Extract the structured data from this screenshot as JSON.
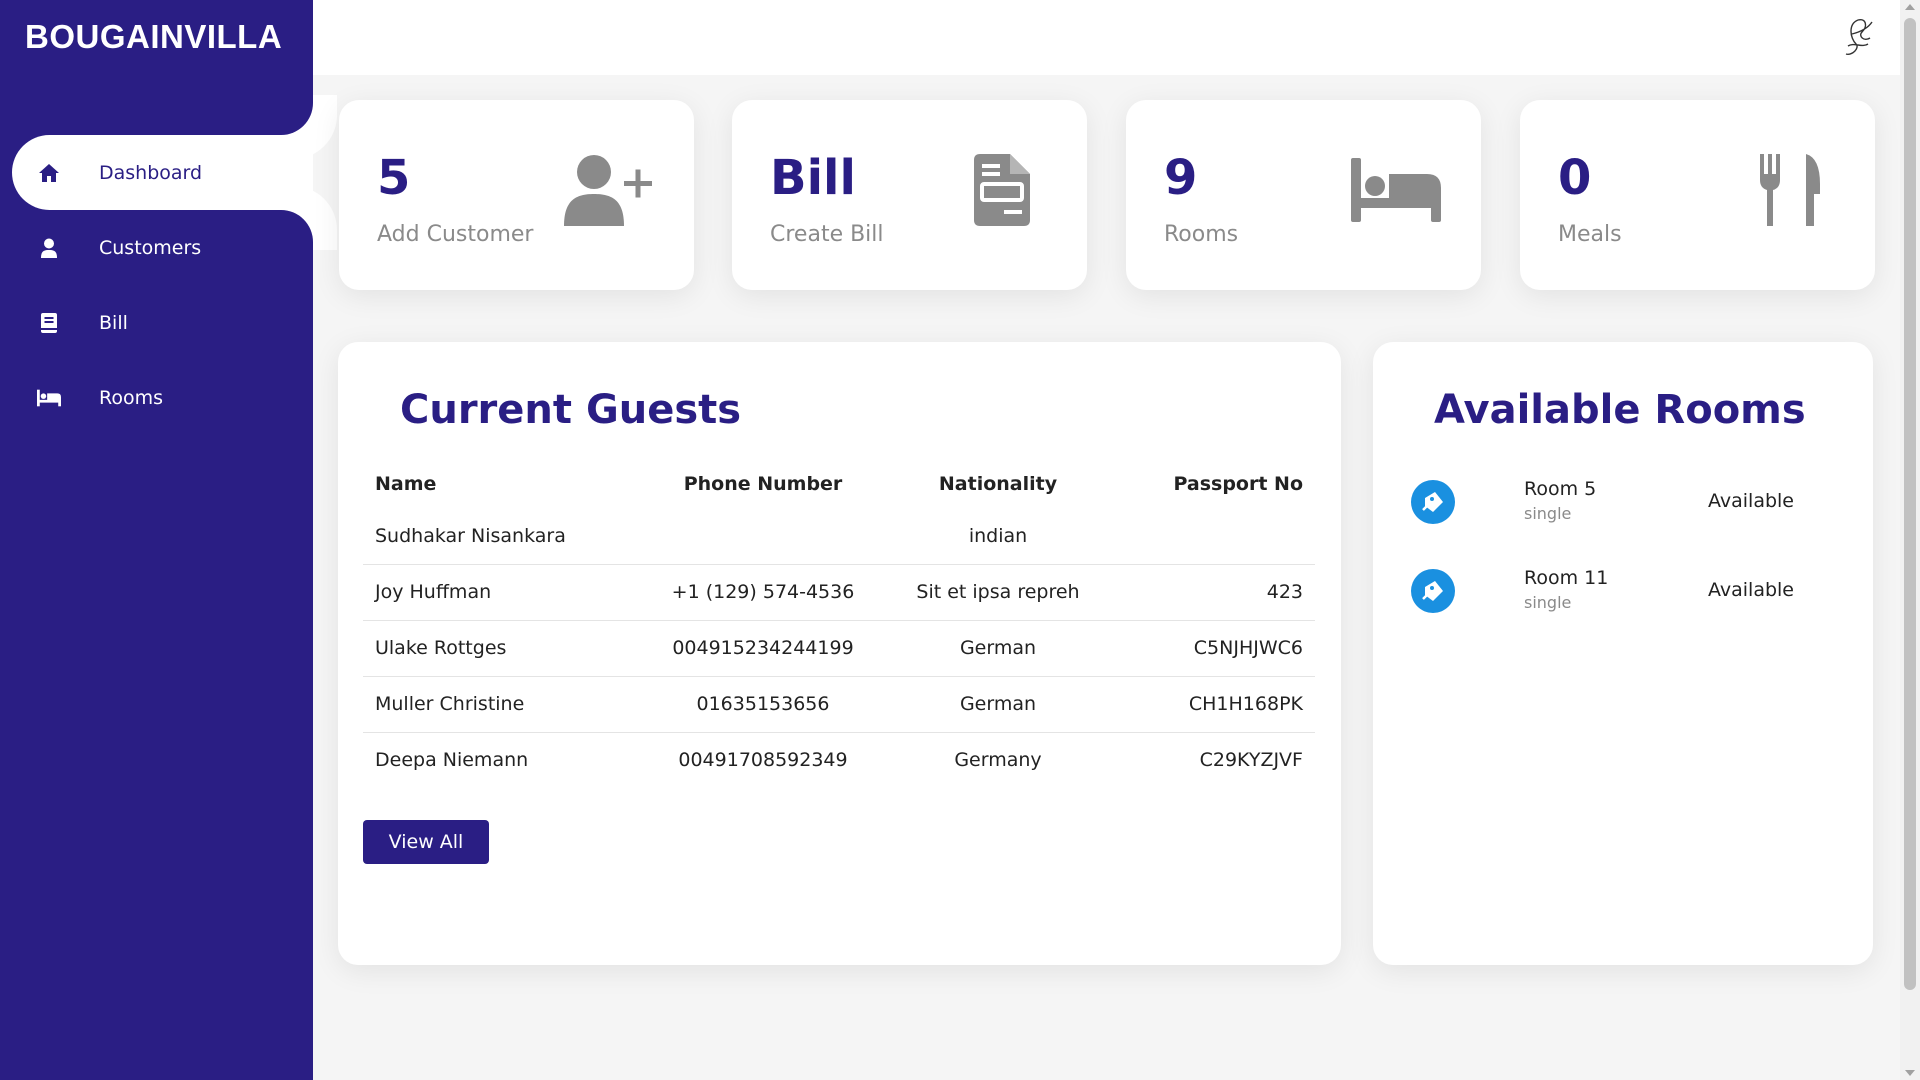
{
  "brand": "BOUGAINVILLA",
  "nav": {
    "items": [
      {
        "label": "Dashboard",
        "icon": "home-icon",
        "active": true
      },
      {
        "label": "Customers",
        "icon": "user-icon"
      },
      {
        "label": "Bill",
        "icon": "book-icon"
      },
      {
        "label": "Rooms",
        "icon": "bed-icon"
      }
    ]
  },
  "cards": [
    {
      "value": "5",
      "label": "Add Customer",
      "icon": "add-user-icon"
    },
    {
      "value": "Bill",
      "label": "Create Bill",
      "icon": "document-icon"
    },
    {
      "value": "9",
      "label": "Rooms",
      "icon": "bed-icon"
    },
    {
      "value": "0",
      "label": "Meals",
      "icon": "utensils-icon"
    }
  ],
  "guests": {
    "title": "Current Guests",
    "columns": [
      "Name",
      "Phone Number",
      "Nationality",
      "Passport No"
    ],
    "rows": [
      {
        "name": "Sudhakar Nisankara",
        "phone": "",
        "nationality": "indian",
        "passport": ""
      },
      {
        "name": "Joy Huffman",
        "phone": "+1 (129) 574-4536",
        "nationality": "Sit et ipsa repreh",
        "passport": "423"
      },
      {
        "name": "Ulake Rottges",
        "phone": "004915234244199",
        "nationality": "German",
        "passport": "C5NJHJWC6"
      },
      {
        "name": "Muller Christine",
        "phone": "01635153656",
        "nationality": "German",
        "passport": "CH1H168PK"
      },
      {
        "name": "Deepa Niemann",
        "phone": "00491708592349",
        "nationality": "Germany",
        "passport": "C29KYZJVF"
      }
    ],
    "view_all_label": "View All"
  },
  "rooms": {
    "title": "Available Rooms",
    "items": [
      {
        "name": "Room 5",
        "type": "single",
        "status": "Available"
      },
      {
        "name": "Room 11",
        "type": "single",
        "status": "Available"
      }
    ]
  },
  "colors": {
    "primary": "#2a1e84",
    "muted": "#8a8a8a",
    "room_icon": "#1a90e0"
  }
}
